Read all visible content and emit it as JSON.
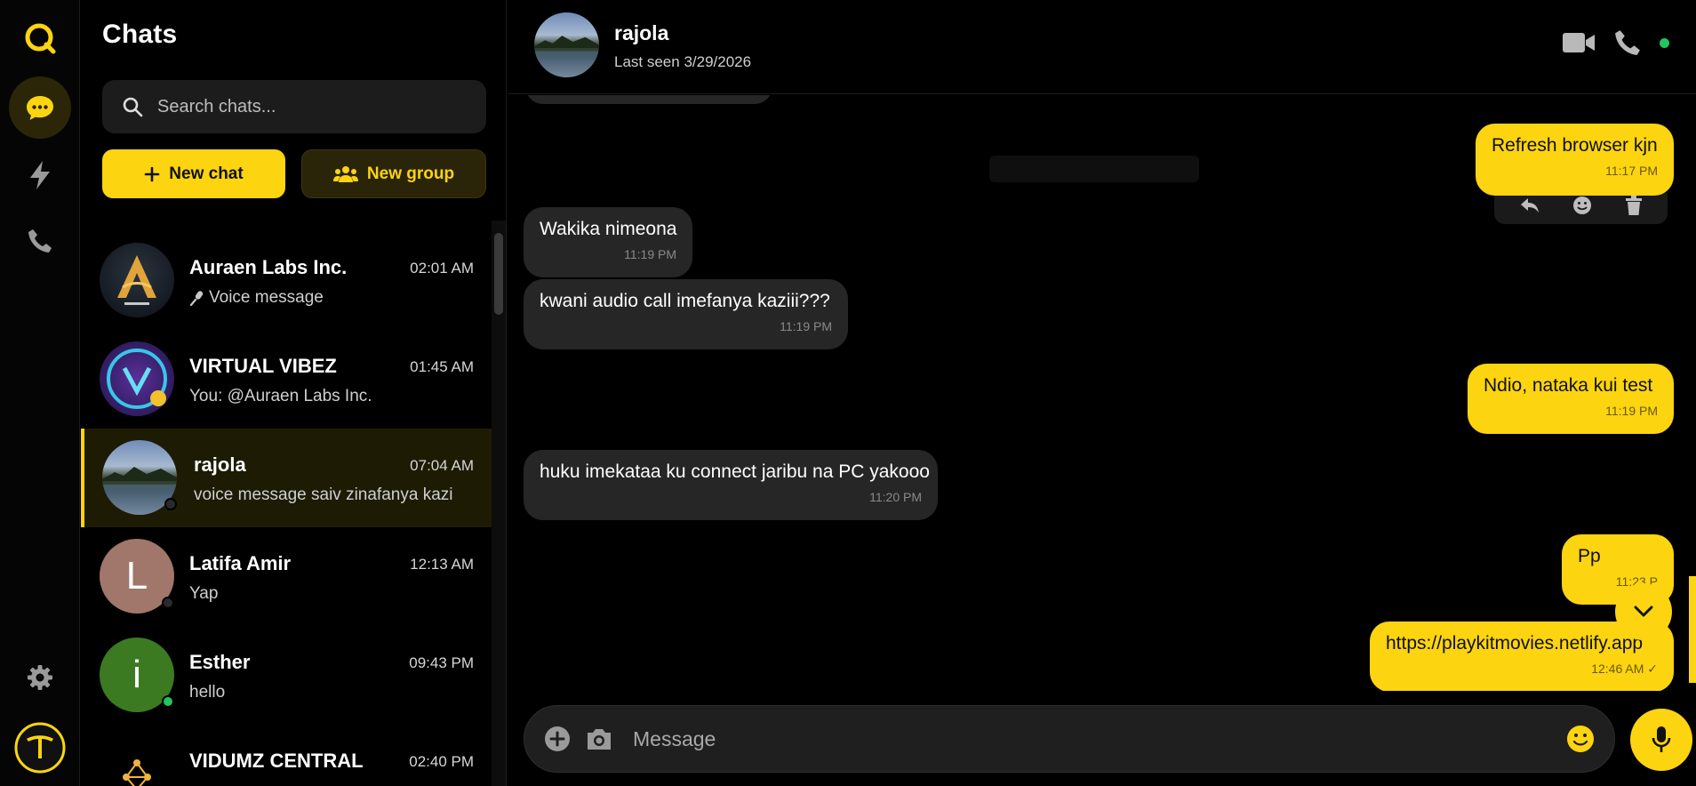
{
  "sidebar": {
    "title": "Chats",
    "search_placeholder": "Search chats...",
    "new_chat_label": "New chat",
    "new_group_label": "New group"
  },
  "chats": [
    {
      "name": "Auraen Labs Inc.",
      "time": "02:01 AM",
      "preview": "Voice message",
      "preview_icon": "microphone-icon"
    },
    {
      "name": "VIRTUAL VIBEZ",
      "time": "01:45 AM",
      "preview": "You: @Auraen Labs Inc."
    },
    {
      "name": "rajola",
      "time": "07:04 AM",
      "preview": "voice message saiv zinafanya kazi",
      "selected": true
    },
    {
      "name": "Latifa Amir",
      "time": "12:13 AM",
      "preview": "Yap",
      "initial": "L",
      "avatar_color": "#a0776a"
    },
    {
      "name": "Esther",
      "time": "09:43 PM",
      "preview": "hello",
      "initial": "i",
      "avatar_color": "#3c7a22"
    },
    {
      "name": "VIDUMZ CENTRAL",
      "time": "02:40 PM",
      "preview": ""
    }
  ],
  "conversation": {
    "name": "rajola",
    "last_seen": "Last seen 3/29/2026",
    "composer_placeholder": "Message",
    "messages": [
      {
        "dir": "out",
        "text": "Refresh browser kjn",
        "time": "11:17 PM"
      },
      {
        "dir": "in",
        "text": "Wakika nimeona",
        "time": "11:19 PM"
      },
      {
        "dir": "in",
        "text": "kwani audio call imefanya kaziii???",
        "time": "11:19 PM"
      },
      {
        "dir": "out",
        "text": "Ndio, nataka kui test",
        "time": "11:19 PM"
      },
      {
        "dir": "in",
        "text": "huku imekataa ku connect jaribu na PC yakooo",
        "time": "11:20 PM"
      },
      {
        "dir": "out",
        "text": "Pp",
        "time": "11:23 P"
      },
      {
        "dir": "out",
        "text": "https://playkitmovies.netlify.app",
        "time": "12:46 AM ✓"
      }
    ]
  },
  "colors": {
    "accent": "#fcd410",
    "incoming_bubble": "#262626",
    "online": "#22c55e"
  }
}
